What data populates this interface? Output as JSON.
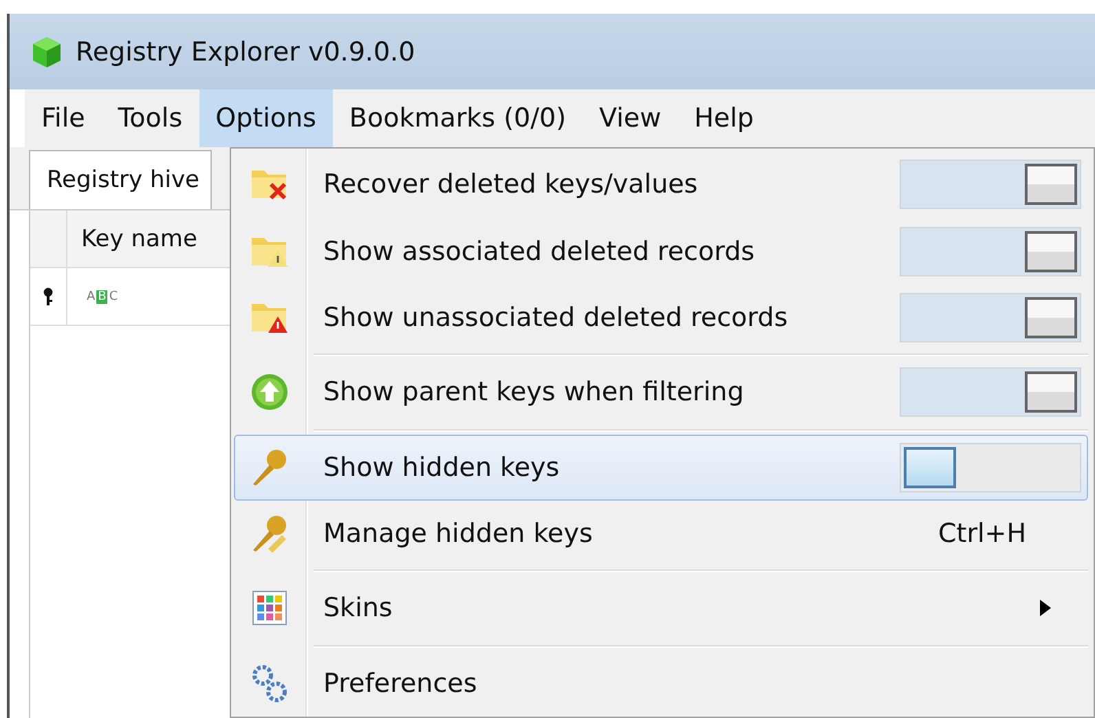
{
  "window": {
    "title": "Registry Explorer v0.9.0.0"
  },
  "menu_bar": [
    {
      "label": "File",
      "selected": false
    },
    {
      "label": "Tools",
      "selected": false
    },
    {
      "label": "Options",
      "selected": true
    },
    {
      "label": "Bookmarks (0/0)",
      "selected": false
    },
    {
      "label": "View",
      "selected": false
    },
    {
      "label": "Help",
      "selected": false
    }
  ],
  "tabs": [
    {
      "label": "Registry hive"
    }
  ],
  "grid": {
    "columns": [
      "Key name"
    ],
    "filter_row": {
      "text": "ABC"
    }
  },
  "options_menu": {
    "groups": [
      [
        {
          "kind": "toggle",
          "label": "Recover deleted keys/values",
          "on": true,
          "selected": false
        },
        {
          "kind": "toggle",
          "label": "Show associated deleted records",
          "on": true,
          "selected": false
        },
        {
          "kind": "toggle",
          "label": "Show unassociated deleted records",
          "on": true,
          "selected": false
        }
      ],
      [
        {
          "kind": "toggle",
          "label": "Show parent keys when filtering",
          "on": true,
          "selected": false
        }
      ],
      [
        {
          "kind": "toggle",
          "label": "Show hidden keys",
          "on": false,
          "selected": true
        },
        {
          "kind": "shortcut",
          "label": "Manage hidden keys",
          "shortcut": "Ctrl+H",
          "selected": false
        }
      ],
      [
        {
          "kind": "submenu",
          "label": "Skins",
          "selected": false
        }
      ],
      [
        {
          "kind": "plain",
          "label": "Preferences",
          "selected": false
        }
      ]
    ]
  }
}
